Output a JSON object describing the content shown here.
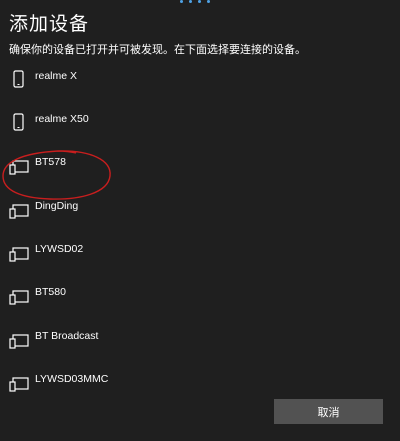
{
  "dialog": {
    "title": "添加设备",
    "subtitle": "确保你的设备已打开并可被发现。在下面选择要连接的设备。"
  },
  "devices": [
    {
      "name": "realme X",
      "icon": "phone-icon"
    },
    {
      "name": "realme X50",
      "icon": "phone-icon"
    },
    {
      "name": "BT578",
      "icon": "display-device-icon",
      "annotated": true
    },
    {
      "name": "DingDing",
      "icon": "display-device-icon"
    },
    {
      "name": "LYWSD02",
      "icon": "display-device-icon"
    },
    {
      "name": "BT580",
      "icon": "display-device-icon"
    },
    {
      "name": "BT Broadcast",
      "icon": "display-device-icon"
    },
    {
      "name": "LYWSD03MMC",
      "icon": "display-device-icon"
    }
  ],
  "footer": {
    "cancel_label": "取消"
  },
  "colors": {
    "background": "#1f1f1f",
    "button": "#525252",
    "annotation": "#c81e1e",
    "progress": "#4fa3e6"
  }
}
